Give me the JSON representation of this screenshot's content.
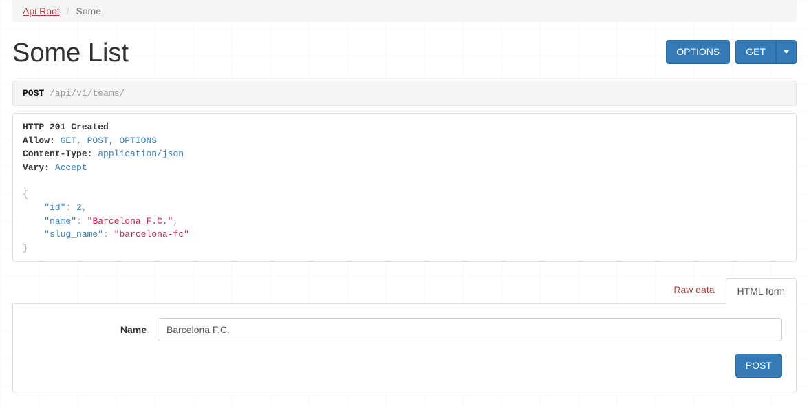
{
  "breadcrumb": {
    "root": "Api Root",
    "current": "Some"
  },
  "title": "Some List",
  "buttons": {
    "options": "OPTIONS",
    "get": "GET"
  },
  "request": {
    "method": "POST",
    "path_segments": [
      "api",
      "v1",
      "teams"
    ]
  },
  "response": {
    "status": "HTTP 201 Created",
    "headers": {
      "Allow": "GET, POST, OPTIONS",
      "Content-Type": "application/json",
      "Vary": "Accept"
    },
    "body": {
      "id": 2,
      "name": "Barcelona F.C.",
      "slug_name": "barcelona-fc"
    }
  },
  "tabs": {
    "raw": "Raw data",
    "html": "HTML form"
  },
  "form": {
    "name_label": "Name",
    "name_value": "Barcelona F.C.",
    "submit": "POST"
  }
}
